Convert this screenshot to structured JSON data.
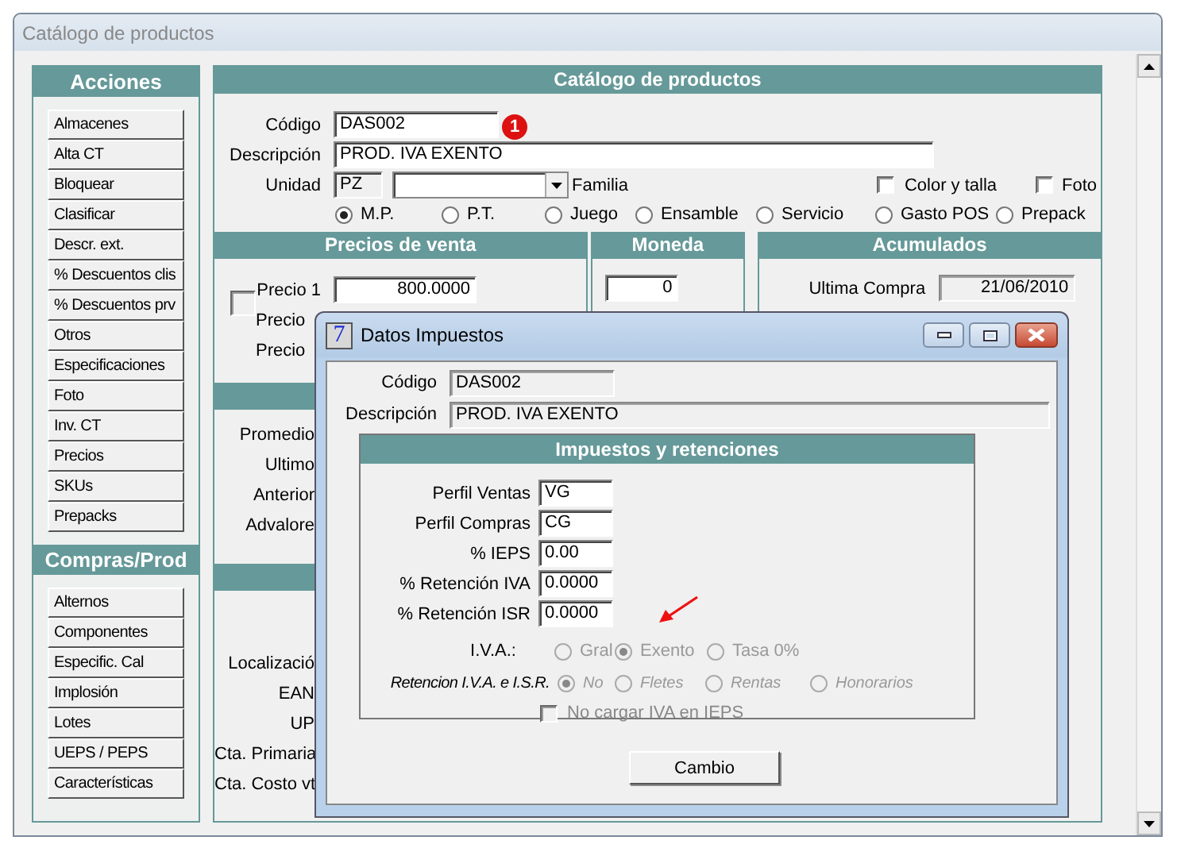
{
  "window": {
    "title": "Catálogo de productos"
  },
  "sidebar": [
    {
      "title": "Acciones",
      "items": [
        "Almacenes",
        "Alta CT",
        "Bloquear",
        "Clasificar",
        "Descr. ext.",
        "%  Descuentos clis",
        "%  Descuentos prv",
        "Otros",
        "Especificaciones",
        "Foto",
        "Inv. CT",
        "Precios",
        "SKUs",
        "Prepacks"
      ]
    },
    {
      "title": "Compras/Prod",
      "items": [
        "Alternos",
        "Componentes",
        "Especific. Cal",
        "Implosión",
        "Lotes",
        "UEPS / PEPS",
        "Características"
      ]
    }
  ],
  "catalog": {
    "title": "Catálogo de productos",
    "fields": [
      {
        "label": "Código",
        "value": "DAS002"
      },
      {
        "label": "Descripción",
        "value": "PROD.  IVA EXENTO"
      }
    ],
    "badge": "1",
    "unit": {
      "label": "Unidad",
      "value": "PZ"
    },
    "family": {
      "label": "Familia"
    },
    "checkboxes": [
      {
        "label": "Color y talla",
        "checked": false
      },
      {
        "label": "Foto",
        "checked": false
      }
    ],
    "types": [
      {
        "label": "M.P.",
        "selected": true
      },
      {
        "label": "P.T.",
        "selected": false
      },
      {
        "label": "Juego",
        "selected": false
      },
      {
        "label": "Ensamble",
        "selected": false
      },
      {
        "label": "Servicio",
        "selected": false
      },
      {
        "label": "Gasto POS",
        "selected": false
      },
      {
        "label": "Prepack",
        "selected": false
      }
    ]
  },
  "prices": {
    "title": "Precios de venta",
    "checkbox": {
      "checked": false
    },
    "rows": [
      {
        "label": "Precio 1",
        "value": "800.0000"
      },
      {
        "label": "Precio"
      },
      {
        "label": "Precio"
      }
    ]
  },
  "costs": {
    "labels": [
      "Promedio",
      "Ultimo",
      "Anterior",
      "Advalore"
    ]
  },
  "codes": {
    "labels": [
      "Localizació",
      "EAN",
      "UP",
      "Cta. Primaria",
      "Cta. Costo vt"
    ]
  },
  "currency": {
    "title": "Moneda",
    "value": "0"
  },
  "totals": {
    "title": "Acumulados",
    "rows": [
      {
        "label": "Ultima  Compra",
        "value": "21/06/2010"
      }
    ]
  },
  "dialog": {
    "title": "Datos Impuestos",
    "icon_text": "7",
    "fields": [
      {
        "label": "Código",
        "value": "DAS002"
      },
      {
        "label": "Descripción",
        "value": "PROD.  IVA EXENTO"
      }
    ],
    "group": {
      "title": "Impuestos y retenciones",
      "inputs": [
        {
          "label": "Perfil Ventas",
          "value": "VG"
        },
        {
          "label": "Perfil Compras",
          "value": "CG"
        },
        {
          "label": "% IEPS",
          "value": "0.00"
        },
        {
          "label": "% Retención IVA",
          "value": "0.0000"
        },
        {
          "label": "% Retención ISR",
          "value": "0.0000"
        }
      ],
      "iva": {
        "label": "I.V.A.:",
        "disabled": true,
        "options": [
          {
            "label": "Gral",
            "selected": false
          },
          {
            "label": "Exento",
            "selected": true
          },
          {
            "label": "Tasa 0%",
            "selected": false
          }
        ]
      },
      "retention": {
        "label": "Retencion I.V.A. e I.S.R.",
        "disabled": true,
        "options": [
          {
            "label": "No",
            "selected": true
          },
          {
            "label": "Fletes",
            "selected": false
          },
          {
            "label": "Rentas",
            "selected": false
          },
          {
            "label": "Honorarios",
            "selected": false
          }
        ]
      },
      "no_iva": {
        "label": "No cargar IVA en IEPS",
        "checked": false,
        "disabled": true
      }
    },
    "button": "Cambio"
  }
}
